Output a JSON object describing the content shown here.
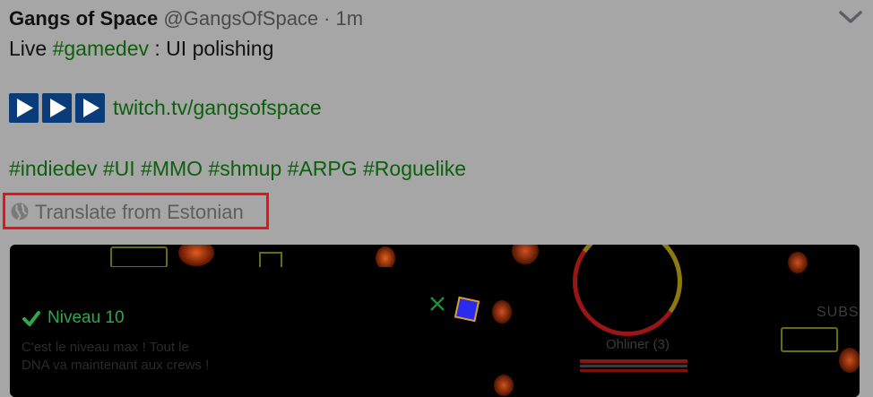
{
  "tweet": {
    "display_name": "Gangs of Space",
    "handle": "@GangsOfSpace",
    "separator": "·",
    "time": "1m",
    "text_live": "Live",
    "hashtag_gamedev": "#gamedev",
    "text_rest": ": UI polishing",
    "link": "twitch.tv/gangsofspace",
    "hashtags": "#indiedev #UI #MMO #shmup #ARPG #Roguelike"
  },
  "translate": {
    "label": "Translate from Estonian",
    "highlight_color": "#e4141a"
  },
  "media": {
    "level_label": "Niveau 10",
    "description_line1": "C'est le niveau max ! Tout le",
    "description_line2": "DNA va maintenant aux crews !",
    "player_name": "Ohliner (3)",
    "corner_text": "SUBS"
  },
  "icons": [
    "chevron-down-icon",
    "play-icon",
    "globe-icon",
    "check-icon",
    "close-icon"
  ],
  "colors": {
    "background": "#a6a6a6",
    "hashtag": "#0c5f0c",
    "play_button": "#0a3c7a",
    "level_green": "#2fa84a"
  }
}
